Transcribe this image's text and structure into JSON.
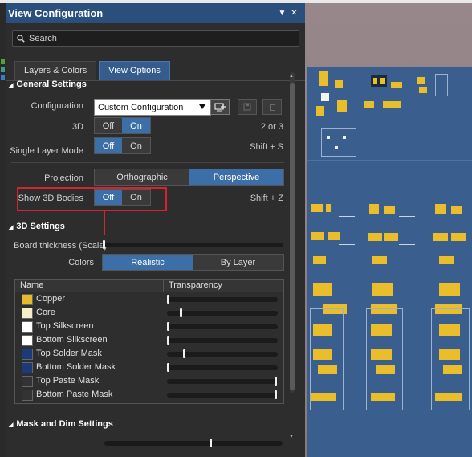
{
  "window": {
    "title": "View Configuration",
    "menu_glyph": "▼",
    "close_glyph": "✕"
  },
  "search": {
    "placeholder": "Search"
  },
  "tabs": [
    {
      "label": "Layers & Colors",
      "active": false
    },
    {
      "label": "View Options",
      "active": true
    }
  ],
  "general_settings": {
    "heading": "General Settings",
    "configuration": {
      "label": "Configuration",
      "value": "Custom Configuration"
    },
    "three_d": {
      "label": "3D",
      "off": "Off",
      "on": "On",
      "selected": "On",
      "shortcut": "2 or 3"
    },
    "single_layer_mode": {
      "label": "Single Layer Mode",
      "off": "Off",
      "on": "On",
      "selected": "Off",
      "shortcut": "Shift + S"
    },
    "projection": {
      "label": "Projection",
      "orthographic": "Orthographic",
      "perspective": "Perspective",
      "selected": "Perspective"
    },
    "show_3d_bodies": {
      "label": "Show 3D Bodies",
      "off": "Off",
      "on": "On",
      "selected": "Off",
      "shortcut": "Shift + Z"
    }
  },
  "three_d_settings": {
    "heading": "3D Settings",
    "board_thickness": {
      "label": "Board thickness (Scale)",
      "level": 0.0
    },
    "colors": {
      "label": "Colors",
      "realistic": "Realistic",
      "by_layer": "By Layer",
      "selected": "Realistic"
    },
    "table": {
      "columns": [
        "Name",
        "Transparency"
      ],
      "rows": [
        {
          "name": "Copper",
          "color": "#e9b92c",
          "transparency": 0.0
        },
        {
          "name": "Core",
          "color": "#f3f0c8",
          "transparency": 0.12
        },
        {
          "name": "Top Silkscreen",
          "color": "#ffffff",
          "transparency": 0.0
        },
        {
          "name": "Bottom Silkscreen",
          "color": "#ffffff",
          "transparency": 0.0
        },
        {
          "name": "Top Solder Mask",
          "color": "#1c3a7a",
          "transparency": 0.15
        },
        {
          "name": "Bottom Solder Mask",
          "color": "#1c3a7a",
          "transparency": 0.0
        },
        {
          "name": "Top Paste Mask",
          "color": "#333333",
          "transparency": 1.0
        },
        {
          "name": "Bottom Paste Mask",
          "color": "#333333",
          "transparency": 1.0
        }
      ]
    }
  },
  "mask_and_dim": {
    "heading": "Mask and Dim Settings"
  },
  "colors": {
    "title_bar": "#2b4f7c",
    "accent": "#3c6ea8",
    "highlight": "#d4242c",
    "pcb_board": "#3a5f8e"
  }
}
